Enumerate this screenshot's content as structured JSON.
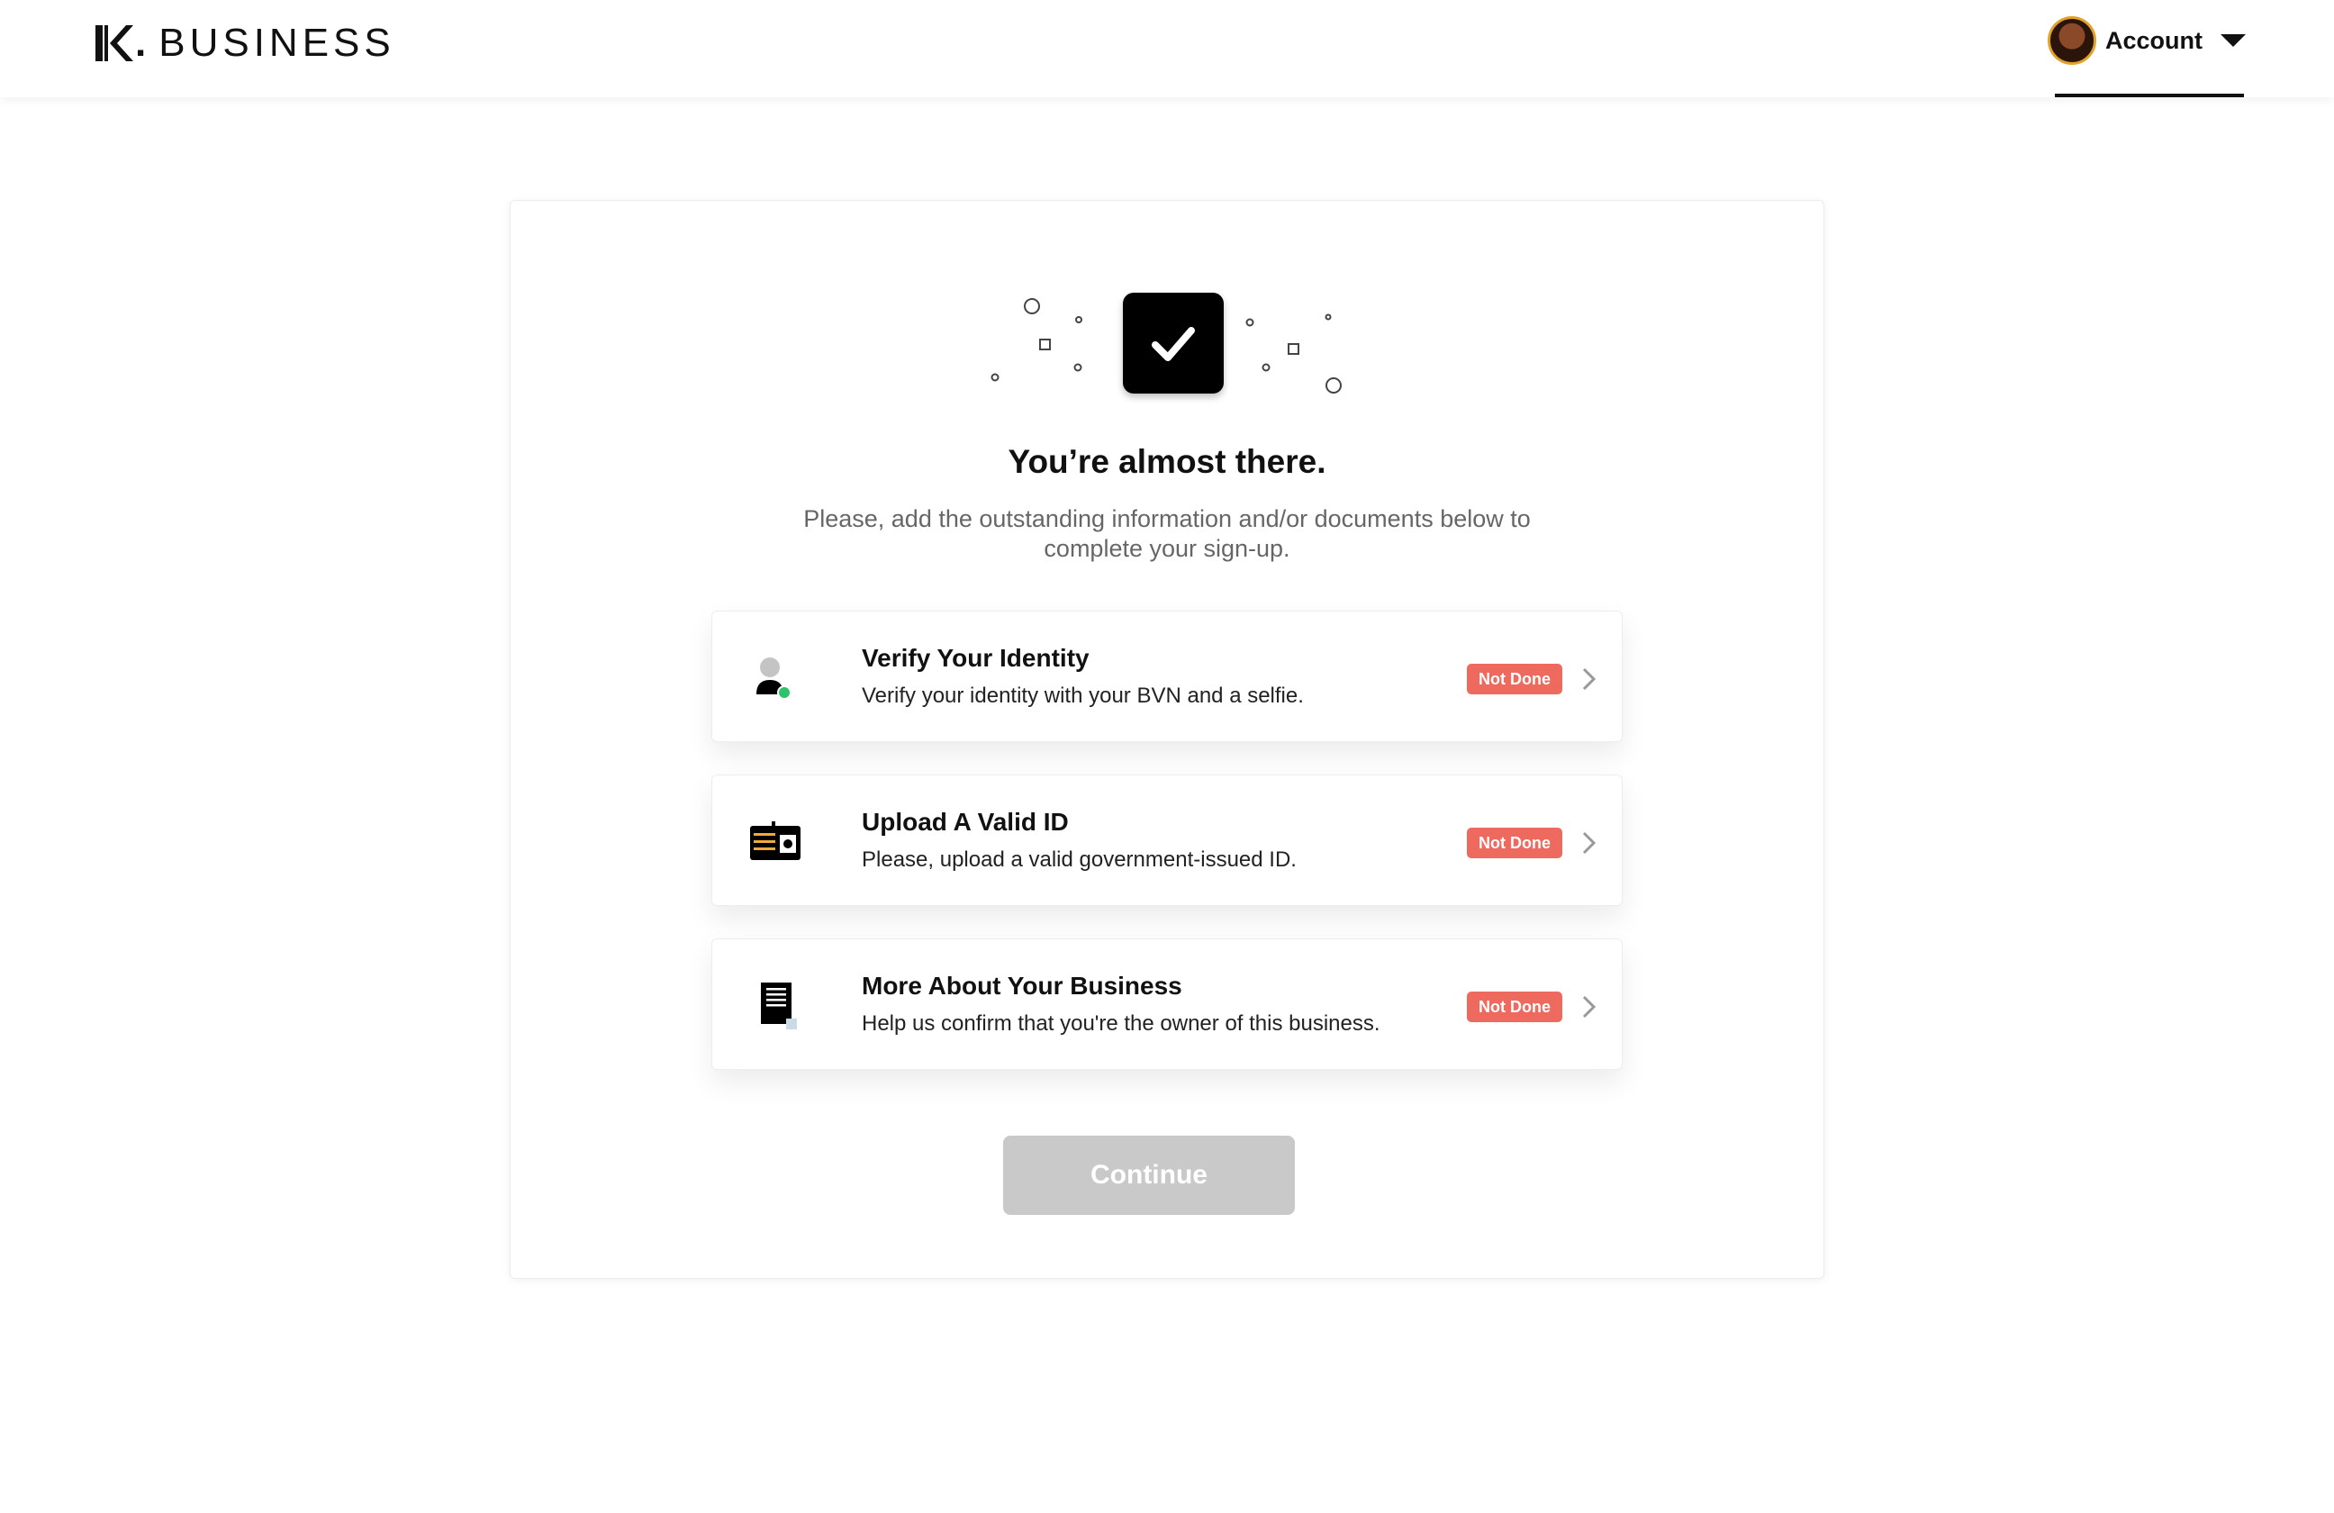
{
  "header": {
    "logo_mark": "K",
    "logo_text": "BUSINESS",
    "account_label": "Account"
  },
  "main": {
    "title": "You’re almost there.",
    "subtitle": "Please, add the outstanding information and/or documents below to complete your sign-up.",
    "tasks": [
      {
        "title": "Verify Your Identity",
        "description": "Verify your identity with your BVN and a selfie.",
        "status": "Not Done",
        "icon": "user-verify-icon"
      },
      {
        "title": "Upload A Valid ID",
        "description": "Please, upload a valid government-issued ID.",
        "status": "Not Done",
        "icon": "id-card-icon"
      },
      {
        "title": "More About Your Business",
        "description": "Help us confirm that you're the owner of this business.",
        "status": "Not Done",
        "icon": "document-icon"
      }
    ],
    "continue_label": "Continue"
  },
  "colors": {
    "badge_bg": "#ef6a5e",
    "button_disabled": "#c9c9c9",
    "avatar_ring": "#e0a228",
    "verify_dot": "#2ec36b"
  }
}
